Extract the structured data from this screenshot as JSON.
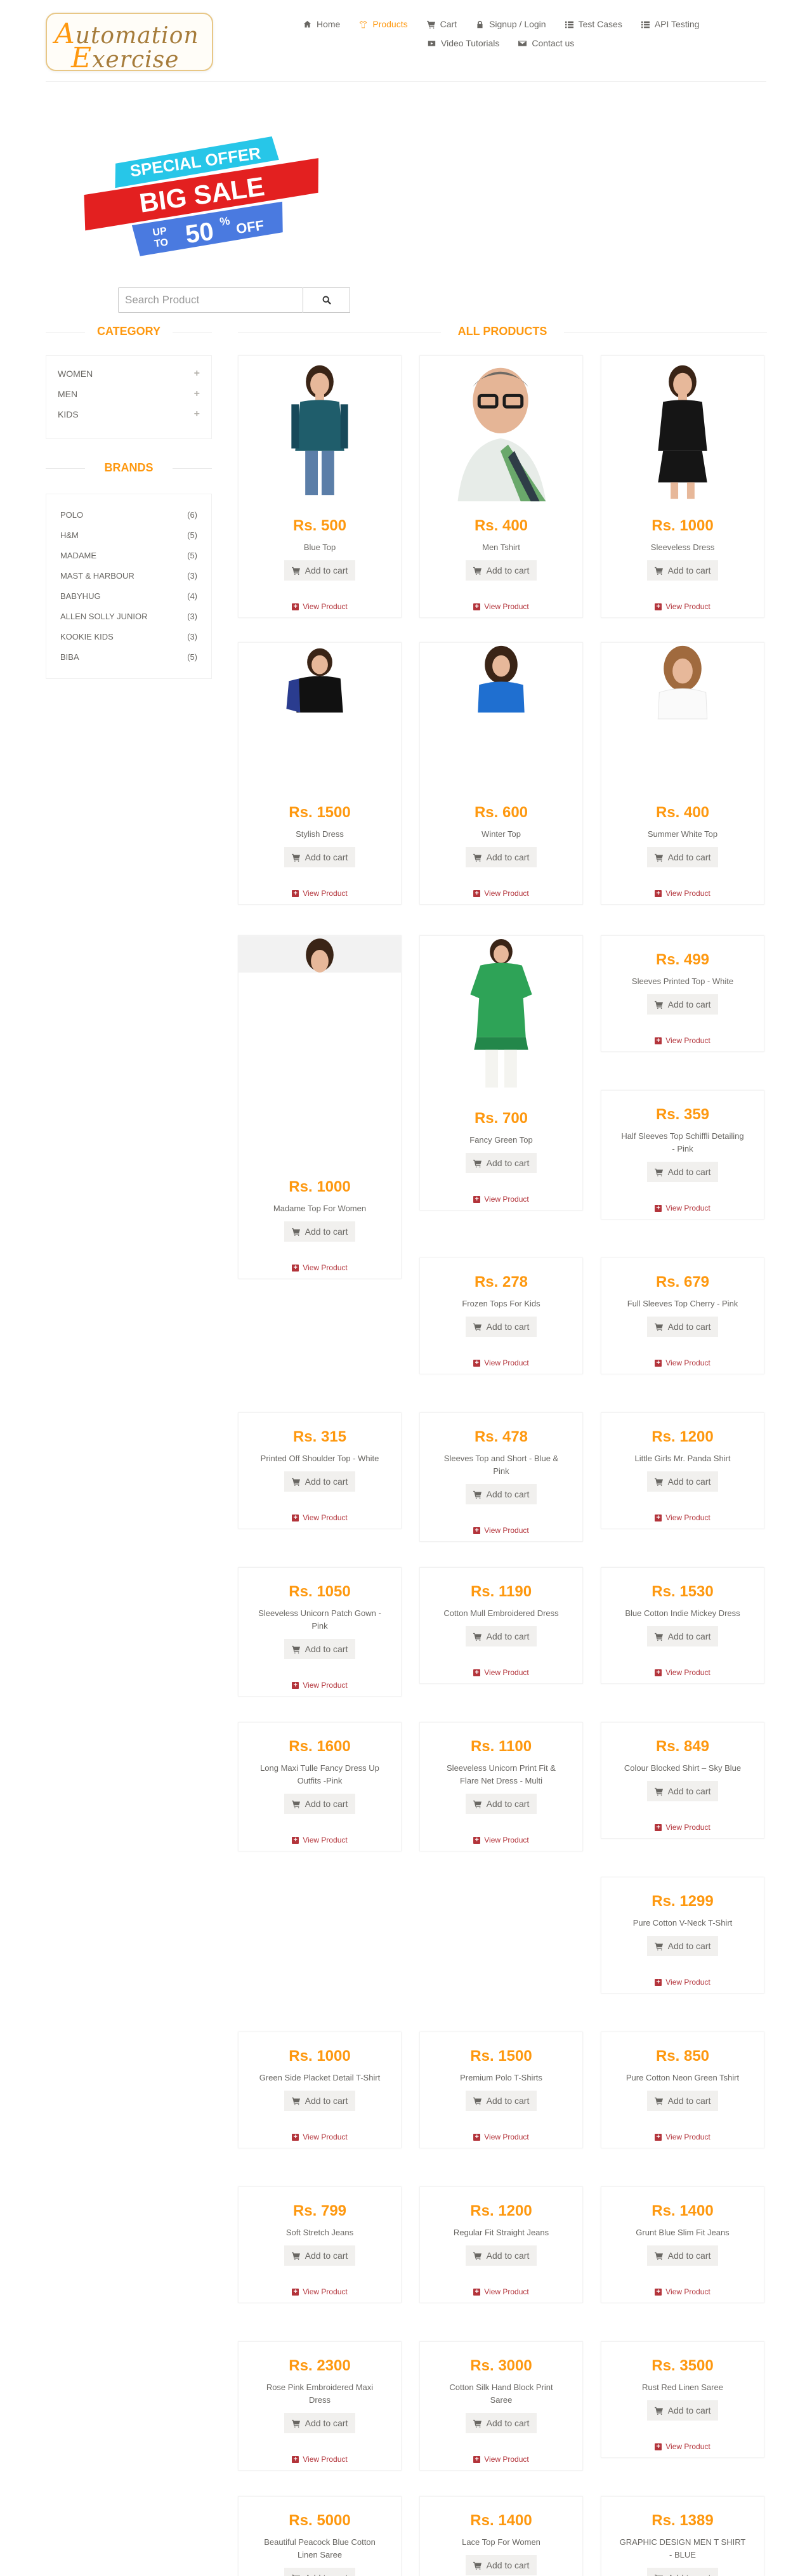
{
  "header": {
    "logo_word1_first": "A",
    "logo_word1_rest": "utomation",
    "logo_word2_first": "E",
    "logo_word2_rest": "xercise",
    "nav": [
      {
        "label": "Home",
        "icon": "home-icon"
      },
      {
        "label": "Products",
        "icon": "tshirt-icon",
        "active": true
      },
      {
        "label": "Cart",
        "icon": "cart-icon"
      },
      {
        "label": "Signup / Login",
        "icon": "lock-icon"
      },
      {
        "label": "Test Cases",
        "icon": "list-icon"
      },
      {
        "label": "API Testing",
        "icon": "list-icon"
      },
      {
        "label": "Video Tutorials",
        "icon": "youtube-icon"
      },
      {
        "label": "Contact us",
        "icon": "envelope-icon"
      }
    ]
  },
  "banner": {
    "line1": "SPECIAL OFFER",
    "line2": "BIG SALE",
    "line3a": "UP",
    "line3b": "TO",
    "line3c": "50",
    "line3d": "%",
    "line3e": "OFF"
  },
  "search": {
    "placeholder": "Search Product",
    "button_icon": "search-icon"
  },
  "sidebar": {
    "category_title": "CATEGORY",
    "categories": [
      "WOMEN",
      "MEN",
      "KIDS"
    ],
    "brands_title": "BRANDS",
    "brands": [
      {
        "name": "POLO",
        "count": "(6)"
      },
      {
        "name": "H&M",
        "count": "(5)"
      },
      {
        "name": "MADAME",
        "count": "(5)"
      },
      {
        "name": "MAST & HARBOUR",
        "count": "(3)"
      },
      {
        "name": "BABYHUG",
        "count": "(4)"
      },
      {
        "name": "ALLEN SOLLY JUNIOR",
        "count": "(3)"
      },
      {
        "name": "KOOKIE KIDS",
        "count": "(3)"
      },
      {
        "name": "BIBA",
        "count": "(5)"
      }
    ]
  },
  "products_title": "ALL PRODUCTS",
  "product_labels": {
    "add_to_cart": "Add to cart",
    "view_product": "View Product"
  },
  "products": [
    {
      "price": "Rs. 500",
      "name": "Blue Top",
      "image": "woman-teal-cardigan"
    },
    {
      "price": "Rs. 400",
      "name": "Men Tshirt",
      "image": "man-glasses-green-shirt"
    },
    {
      "price": "Rs. 1000",
      "name": "Sleeveless Dress",
      "image": "woman-black-dress"
    },
    {
      "price": "Rs. 1500",
      "name": "Stylish Dress",
      "image": "woman-black-top"
    },
    {
      "price": "Rs. 600",
      "name": "Winter Top",
      "image": "woman-blue-top"
    },
    {
      "price": "Rs. 400",
      "name": "Summer White Top",
      "image": "woman-white-top"
    },
    {
      "price": "Rs. 1000",
      "name": "Madame Top For Women",
      "image": "woman-partial"
    },
    {
      "price": "Rs. 700",
      "name": "Fancy Green Top",
      "image": "woman-green-top"
    },
    {
      "price": "Rs. 499",
      "name": "Sleeves Printed Top - White"
    },
    {
      "price": "Rs. 359",
      "name": "Half Sleeves Top Schiffli Detailing - Pink"
    },
    {
      "price": "Rs. 278",
      "name": "Frozen Tops For Kids"
    },
    {
      "price": "Rs. 679",
      "name": "Full Sleeves Top Cherry - Pink"
    },
    {
      "price": "Rs. 315",
      "name": "Printed Off Shoulder Top - White"
    },
    {
      "price": "Rs. 478",
      "name": "Sleeves Top and Short - Blue & Pink"
    },
    {
      "price": "Rs. 1200",
      "name": "Little Girls Mr. Panda Shirt"
    },
    {
      "price": "Rs. 1050",
      "name": "Sleeveless Unicorn Patch Gown - Pink"
    },
    {
      "price": "Rs. 1190",
      "name": "Cotton Mull Embroidered Dress"
    },
    {
      "price": "Rs. 1530",
      "name": "Blue Cotton Indie Mickey Dress"
    },
    {
      "price": "Rs. 1600",
      "name": "Long Maxi Tulle Fancy Dress Up Outfits -Pink"
    },
    {
      "price": "Rs. 1100",
      "name": "Sleeveless Unicorn Print Fit & Flare Net Dress - Multi"
    },
    {
      "price": "Rs. 849",
      "name": "Colour Blocked Shirt – Sky Blue"
    },
    {
      "price": "Rs. 1299",
      "name": "Pure Cotton V-Neck T-Shirt"
    },
    {
      "price": "Rs. 1000",
      "name": "Green Side Placket Detail T-Shirt"
    },
    {
      "price": "Rs. 1500",
      "name": "Premium Polo T-Shirts"
    },
    {
      "price": "Rs. 850",
      "name": "Pure Cotton Neon Green Tshirt"
    },
    {
      "price": "Rs. 799",
      "name": "Soft Stretch Jeans"
    },
    {
      "price": "Rs. 1200",
      "name": "Regular Fit Straight Jeans"
    },
    {
      "price": "Rs. 1400",
      "name": "Grunt Blue Slim Fit Jeans"
    },
    {
      "price": "Rs. 2300",
      "name": "Rose Pink Embroidered Maxi Dress"
    },
    {
      "price": "Rs. 3000",
      "name": "Cotton Silk Hand Block Print Saree"
    },
    {
      "price": "Rs. 3500",
      "name": "Rust Red Linen Saree"
    },
    {
      "price": "Rs. 5000",
      "name": "Beautiful Peacock Blue Cotton Linen Saree"
    },
    {
      "price": "Rs. 1400",
      "name": "Lace Top For Women"
    },
    {
      "price": "Rs. 1389",
      "name": "GRAPHIC DESIGN MEN T SHIRT - BLUE"
    }
  ],
  "colors": {
    "accent": "#FE980F",
    "link": "#B3343B",
    "text": "#696763"
  }
}
